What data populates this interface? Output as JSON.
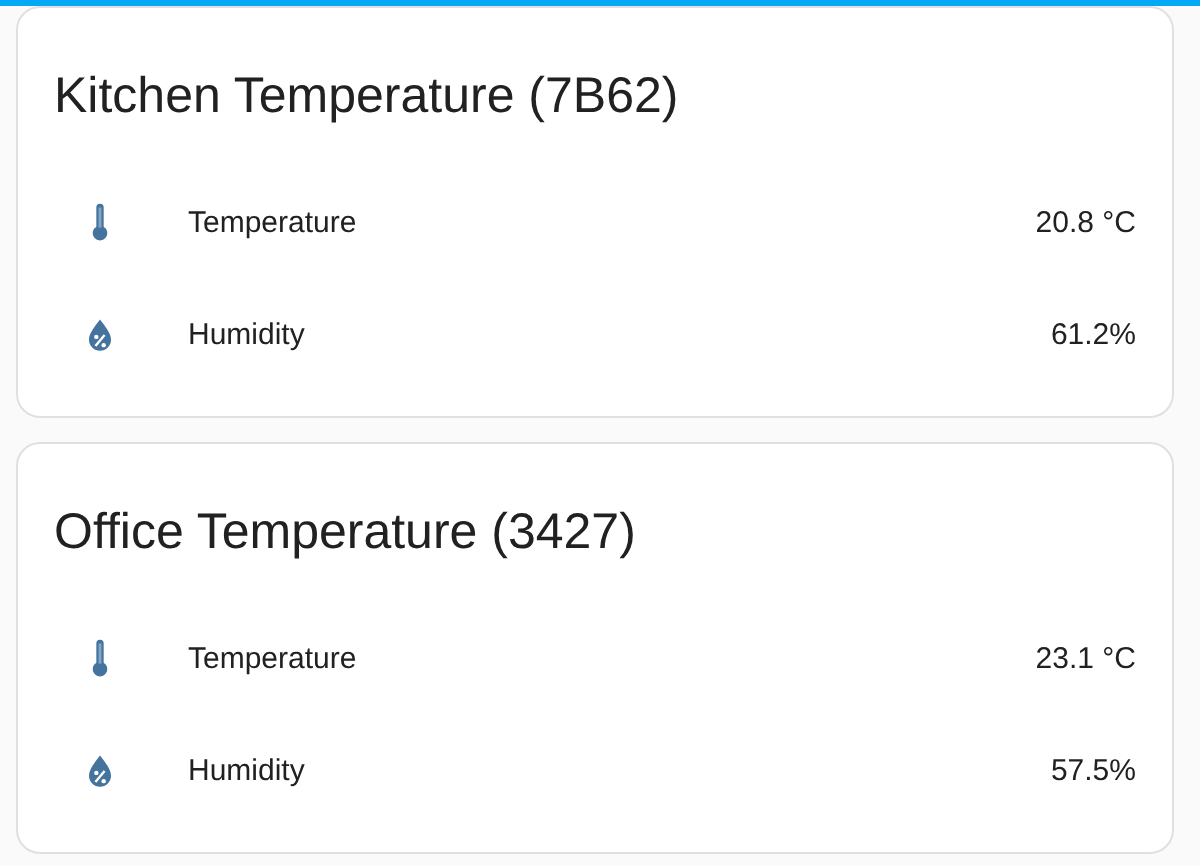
{
  "cards": [
    {
      "title": "Kitchen Temperature (7B62)",
      "rows": [
        {
          "kind": "temperature",
          "label": "Temperature",
          "value": "20.8 °C"
        },
        {
          "kind": "humidity",
          "label": "Humidity",
          "value": "61.2%"
        }
      ]
    },
    {
      "title": "Office Temperature (3427)",
      "rows": [
        {
          "kind": "temperature",
          "label": "Temperature",
          "value": "23.1 °C"
        },
        {
          "kind": "humidity",
          "label": "Humidity",
          "value": "57.5%"
        }
      ]
    }
  ]
}
